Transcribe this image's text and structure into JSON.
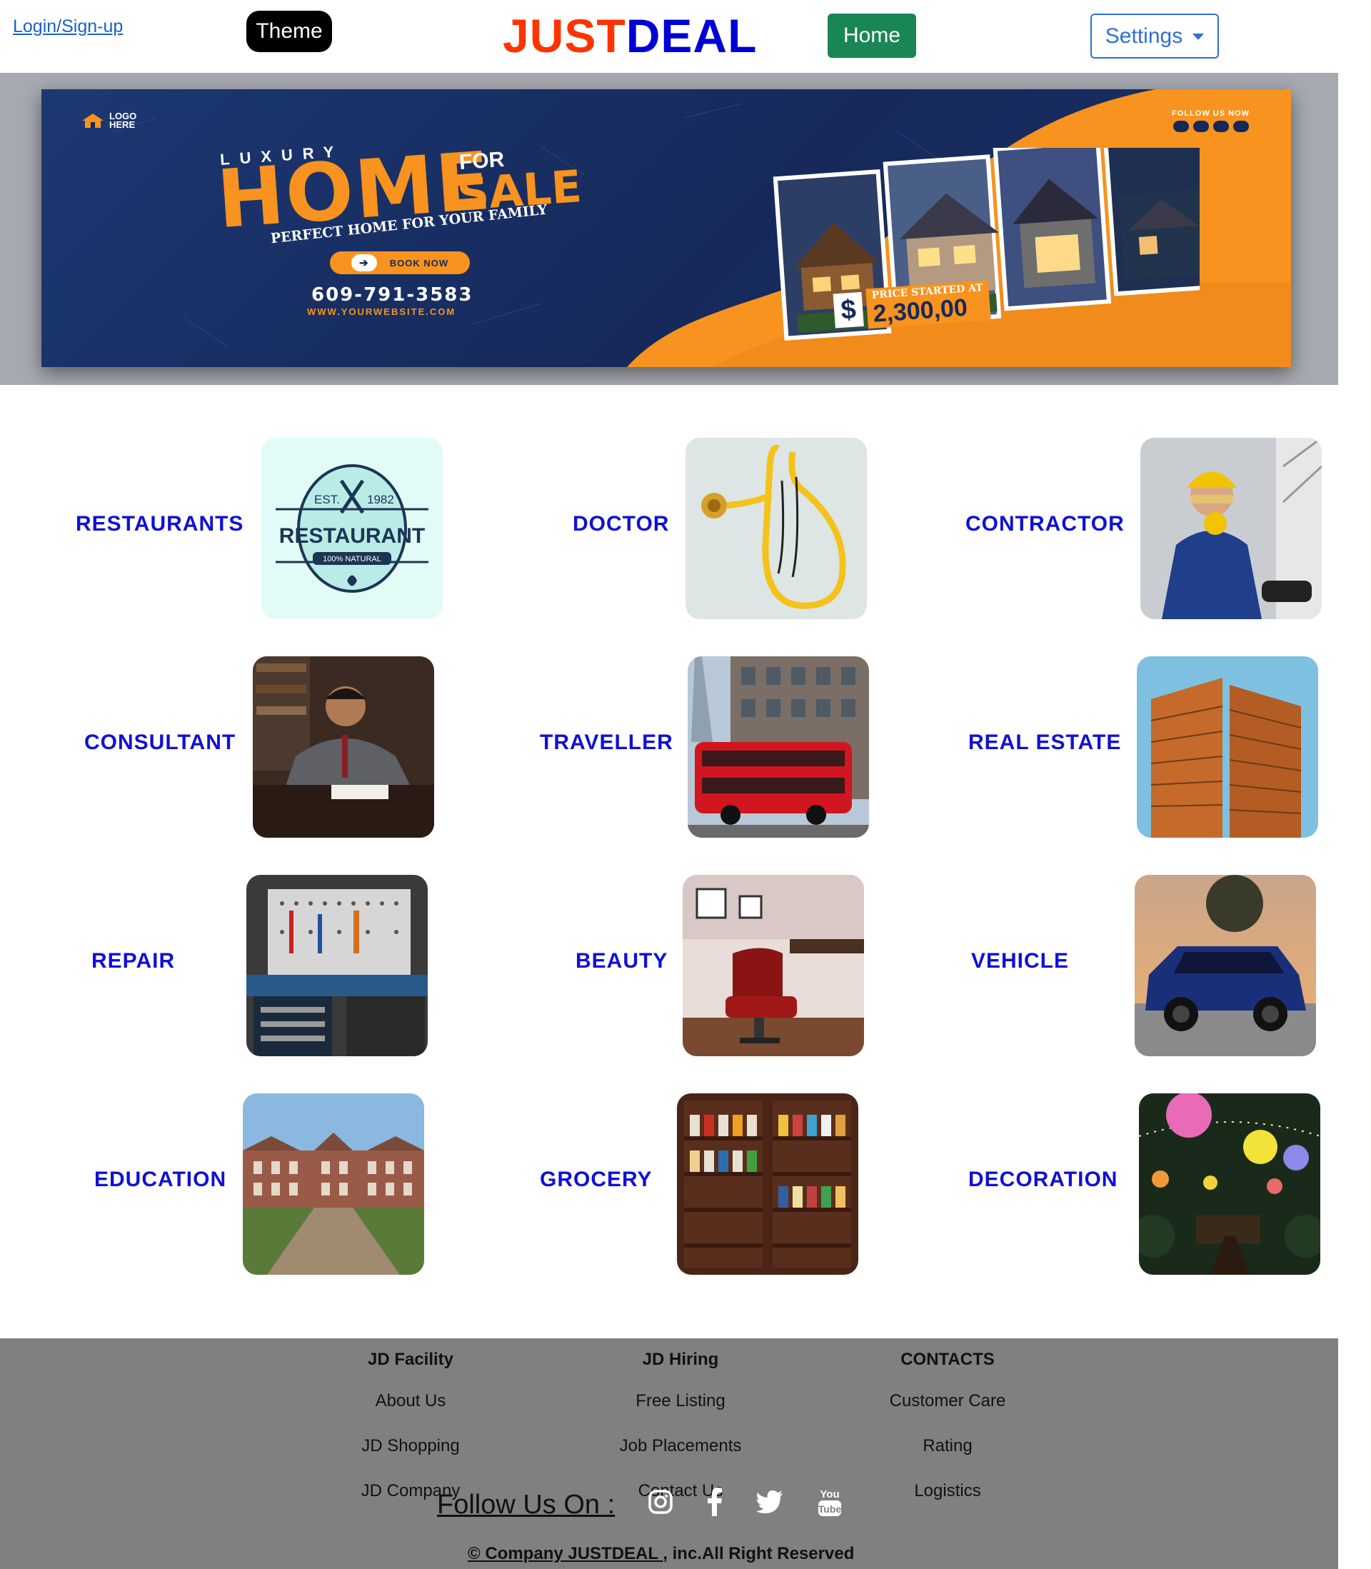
{
  "header": {
    "login_label": "Login/Sign-up",
    "theme_label": "Theme",
    "brand_part1": "JUST",
    "brand_part2": "DEAL",
    "home_label": "Home",
    "settings_label": "Settings"
  },
  "banner": {
    "logo_text_1": "LOGO",
    "logo_text_2": "HERE",
    "follow_text": "FOLLOW US NOW",
    "luxury": "LUXURY",
    "home_word": "HOME",
    "for_word": "FOR",
    "sale_word": "SALE",
    "tagline": "PERFECT HOME FOR YOUR FAMILY",
    "book_now": "BOOK NOW",
    "phone": "609-791-3583",
    "website": "WWW.YOURWEBSITE.COM",
    "price_caption": "PRICE STARTED AT",
    "price_value": "2,300,00",
    "price_symbol": "$"
  },
  "categories": [
    {
      "label": "RESTAURANTS",
      "image": "restaurant-logo-image",
      "badge_top_left": "EST.",
      "badge_top_right": "1982",
      "badge_title": "RESTAURANT",
      "badge_ribbon": "100% NATURAL"
    },
    {
      "label": "DOCTOR",
      "image": "stethoscope-image"
    },
    {
      "label": "CONTRACTOR",
      "image": "contractor-worker-image"
    },
    {
      "label": "CONSULTANT",
      "image": "consultant-writing-image"
    },
    {
      "label": "TRAVELLER",
      "image": "red-bus-image"
    },
    {
      "label": "REAL ESTATE",
      "image": "high-rise-buildings-image"
    },
    {
      "label": "REPAIR",
      "image": "tool-wall-image"
    },
    {
      "label": "BEAUTY",
      "image": "barber-chair-image"
    },
    {
      "label": "VEHICLE",
      "image": "blue-suv-image"
    },
    {
      "label": "EDUCATION",
      "image": "college-building-image"
    },
    {
      "label": "GROCERY",
      "image": "grocery-shelves-image"
    },
    {
      "label": "DECORATION",
      "image": "lanterns-image"
    }
  ],
  "footer": {
    "columns": [
      {
        "title": "JD Facility",
        "links": [
          "About Us",
          "JD Shopping",
          "JD Company"
        ]
      },
      {
        "title": "JD Hiring",
        "links": [
          "Free Listing",
          "Job Placements",
          "Contact Us"
        ]
      },
      {
        "title": "CONTACTS",
        "links": [
          "Customer Care",
          "Rating",
          "Logistics"
        ]
      }
    ],
    "follow_label": "Follow Us On :",
    "social_icons": [
      "instagram-icon",
      "facebook-icon",
      "twitter-icon",
      "youtube-icon"
    ],
    "youtube_text_1": "You",
    "youtube_text_2": "Tube",
    "copyright_link": "© Company JUSTDEAL ",
    "copyright_rest": ", inc.All Right Reserved"
  },
  "colors": {
    "brand_orange": "#ff3300",
    "brand_blue": "#0000d4",
    "category_blue": "#1010d8",
    "home_green": "#198754",
    "settings_blue": "#2e6fd8",
    "banner_navy": "#16295a",
    "banner_orange": "#f7931e",
    "footer_gray": "#808080"
  }
}
